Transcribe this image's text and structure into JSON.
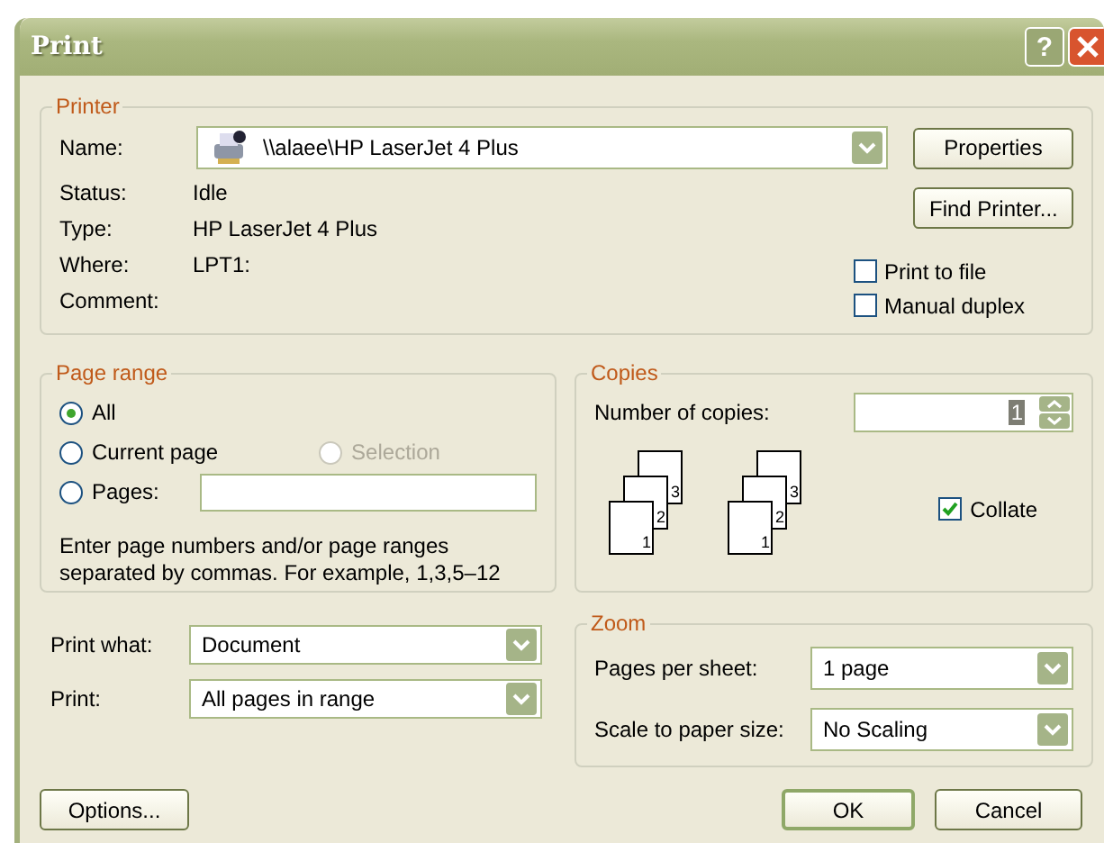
{
  "window": {
    "title": "Print",
    "help": "?"
  },
  "printer": {
    "group_label": "Printer",
    "name_label": "Name:",
    "name_value": "\\\\alaee\\HP LaserJet 4 Plus",
    "info": [
      {
        "label": "Status:",
        "value": "Idle"
      },
      {
        "label": "Type:",
        "value": "HP LaserJet 4 Plus"
      },
      {
        "label": "Where:",
        "value": "LPT1:"
      },
      {
        "label": "Comment:"
      }
    ],
    "properties_button": "Properties",
    "find_button": "Find Printer...",
    "checkboxes": [
      {
        "label": "Print to file",
        "checked": false
      },
      {
        "label": "Manual duplex",
        "checked": false
      }
    ]
  },
  "page_range": {
    "group_label": "Page range",
    "rows": [
      [
        {
          "kind": "radio",
          "label": "All",
          "selected": true,
          "disabled": false
        }
      ],
      [
        {
          "kind": "radio",
          "label": "Current page",
          "selected": false,
          "disabled": false
        },
        {
          "kind": "radio",
          "label": "Selection",
          "selected": false,
          "disabled": true
        }
      ],
      [
        {
          "kind": "radio_field",
          "label": "Pages:",
          "selected": false,
          "disabled": false
        }
      ]
    ],
    "hint": "Enter page numbers and/or page ranges separated by commas.  For example, 1,3,5–12"
  },
  "copies": {
    "group_label": "Copies",
    "number_label": "Number of copies:",
    "number_value": "1",
    "stacks": [
      [
        "3",
        "2",
        "1"
      ],
      [
        "3",
        "2",
        "1"
      ]
    ],
    "collate": {
      "label": "Collate",
      "checked": true
    }
  },
  "print_options": [
    {
      "label": "Print what:",
      "value": "Document"
    },
    {
      "label": "Print:",
      "value": "All pages in range"
    }
  ],
  "zoom": {
    "group_label": "Zoom",
    "rows": [
      {
        "label": "Pages per sheet:",
        "value": "1 page"
      },
      {
        "label": "Scale to paper size:",
        "value": "No Scaling"
      }
    ]
  },
  "buttons": [
    {
      "label": "Options...",
      "default": false
    },
    {
      "label": "OK",
      "default": true
    },
    {
      "label": "Cancel",
      "default": false
    }
  ]
}
